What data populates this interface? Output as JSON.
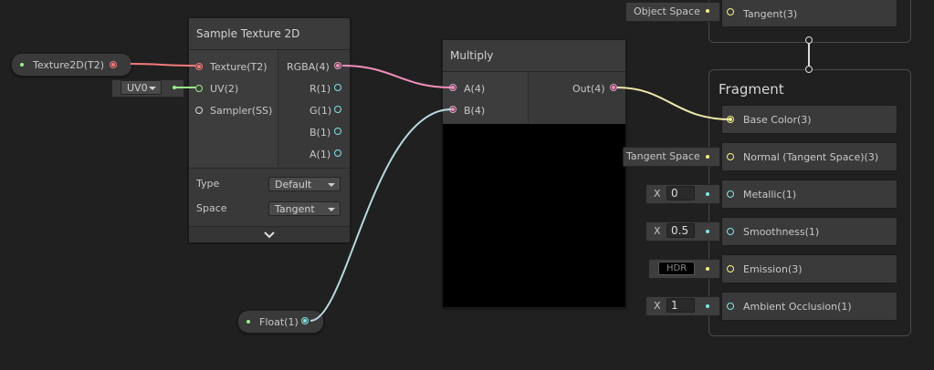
{
  "colors": {
    "background": "#202020",
    "node": "#393939",
    "wire_color_texture": "#f67a7a",
    "wire_vector4": "#f28fbd",
    "wire_float": "#84e4e7",
    "wire_vector3": "#f5f585",
    "wire_vector2": "#9cf08c"
  },
  "sample_texture": {
    "title": "Sample Texture 2D",
    "inputs": [
      "Texture(T2)",
      "UV(2)",
      "Sampler(SS)"
    ],
    "outputs": [
      "RGBA(4)",
      "R(1)",
      "G(1)",
      "B(1)",
      "A(1)"
    ],
    "type_label": "Type",
    "type_value": "Default",
    "space_label": "Space",
    "space_value": "Tangent",
    "expand_icon": "chevron-down-icon"
  },
  "texture_property": {
    "label": "Texture2D(T2)"
  },
  "uv_dropdown": {
    "value": "UV0"
  },
  "float_property": {
    "label": "Float(1)"
  },
  "multiply": {
    "title": "Multiply",
    "inputs": [
      "A(4)",
      "B(4)"
    ],
    "output": "Out(4)"
  },
  "vertex_context": {
    "object_space_label": "Object Space",
    "tangent_slot": "Tangent(3)"
  },
  "fragment": {
    "title": "Fragment",
    "slots": [
      {
        "label": "Base Color(3)"
      },
      {
        "label": "Normal (Tangent Space)(3)",
        "inline": "Tangent Space"
      },
      {
        "label": "Metallic(1)",
        "axis": "X",
        "value": "0"
      },
      {
        "label": "Smoothness(1)",
        "axis": "X",
        "value": "0.5"
      },
      {
        "label": "Emission(3)",
        "inline": "HDR"
      },
      {
        "label": "Ambient Occlusion(1)",
        "axis": "X",
        "value": "1"
      }
    ]
  }
}
